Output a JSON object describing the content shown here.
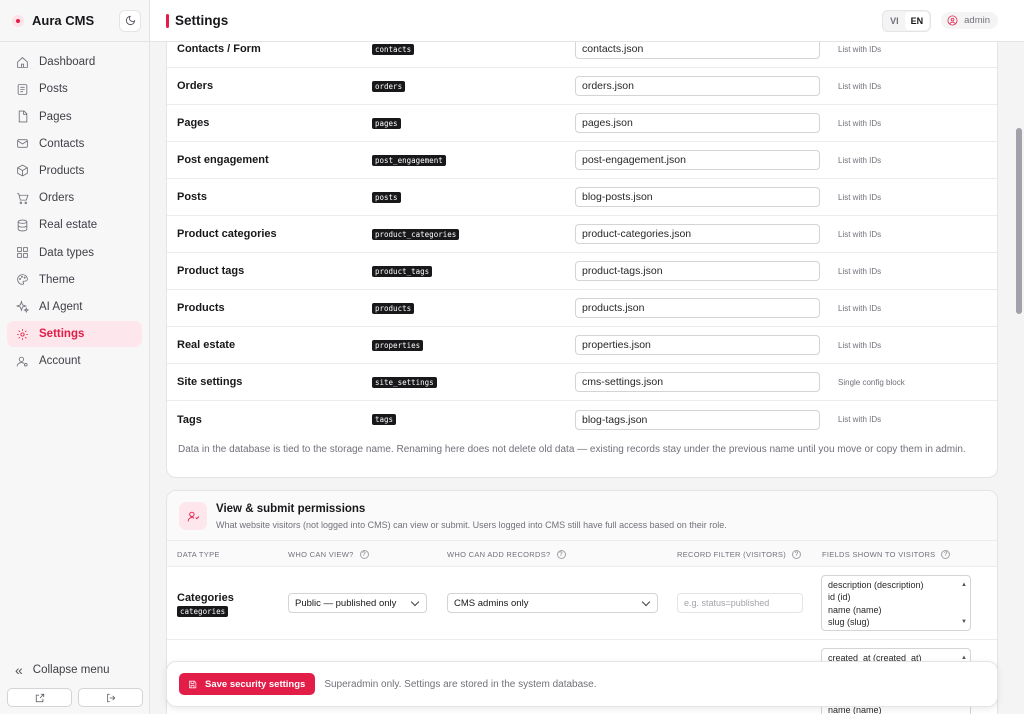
{
  "app": {
    "name": "Aura CMS"
  },
  "header": {
    "title": "Settings",
    "lang_vi": "VI",
    "lang_en": "EN",
    "user": "admin"
  },
  "sidebar": {
    "items": [
      {
        "label": "Dashboard",
        "icon": "home-icon"
      },
      {
        "label": "Posts",
        "icon": "posts-icon"
      },
      {
        "label": "Pages",
        "icon": "page-icon"
      },
      {
        "label": "Contacts",
        "icon": "mail-icon"
      },
      {
        "label": "Products",
        "icon": "box-icon"
      },
      {
        "label": "Orders",
        "icon": "cart-icon"
      },
      {
        "label": "Real estate",
        "icon": "database-icon"
      },
      {
        "label": "Data types",
        "icon": "grid-icon"
      },
      {
        "label": "Theme",
        "icon": "palette-icon"
      },
      {
        "label": "AI Agent",
        "icon": "sparkles-icon"
      },
      {
        "label": "Settings",
        "icon": "gear-icon",
        "active": true
      },
      {
        "label": "Account",
        "icon": "user-icon"
      }
    ],
    "collapse_label": "Collapse menu"
  },
  "storage": {
    "rows": [
      {
        "name": "Contacts / Form",
        "code": "contacts",
        "file": "contacts.json",
        "hint": "List with IDs"
      },
      {
        "name": "Orders",
        "code": "orders",
        "file": "orders.json",
        "hint": "List with IDs"
      },
      {
        "name": "Pages",
        "code": "pages",
        "file": "pages.json",
        "hint": "List with IDs"
      },
      {
        "name": "Post engagement",
        "code": "post_engagement",
        "file": "post-engagement.json",
        "hint": "List with IDs"
      },
      {
        "name": "Posts",
        "code": "posts",
        "file": "blog-posts.json",
        "hint": "List with IDs"
      },
      {
        "name": "Product categories",
        "code": "product_categories",
        "file": "product-categories.json",
        "hint": "List with IDs"
      },
      {
        "name": "Product tags",
        "code": "product_tags",
        "file": "product-tags.json",
        "hint": "List with IDs"
      },
      {
        "name": "Products",
        "code": "products",
        "file": "products.json",
        "hint": "List with IDs"
      },
      {
        "name": "Real estate",
        "code": "properties",
        "file": "properties.json",
        "hint": "List with IDs"
      },
      {
        "name": "Site settings",
        "code": "site_settings",
        "file": "cms-settings.json",
        "hint": "Single config block"
      },
      {
        "name": "Tags",
        "code": "tags",
        "file": "blog-tags.json",
        "hint": "List with IDs"
      }
    ],
    "note": "Data in the database is tied to the storage name. Renaming here does not delete old data — existing records stay under the previous name until you move or copy them in admin."
  },
  "permissions": {
    "title": "View & submit permissions",
    "subtitle": "What website visitors (not logged into CMS) can view or submit. Users logged into CMS still have full access based on their role.",
    "columns": [
      "DATA TYPE",
      "WHO CAN VIEW?",
      "WHO CAN ADD RECORDS?",
      "RECORD FILTER (VISITORS)",
      "FIELDS SHOWN TO VISITORS"
    ],
    "row": {
      "name": "Categories",
      "code": "categories",
      "view": "Public — published only",
      "add": "CMS admins only",
      "filter_placeholder": "e.g. status=published",
      "fields": [
        "description (description)",
        "id (id)",
        "name (name)",
        "slug (slug)"
      ]
    },
    "row2_fields": [
      "created_at (created_at)"
    ],
    "row2_partial": "name (name)"
  },
  "savebar": {
    "button": "Save security settings",
    "note": "Superadmin only. Settings are stored in the system database."
  },
  "colors": {
    "accent": "#e11d48",
    "accent_soft": "#fde7ec"
  }
}
